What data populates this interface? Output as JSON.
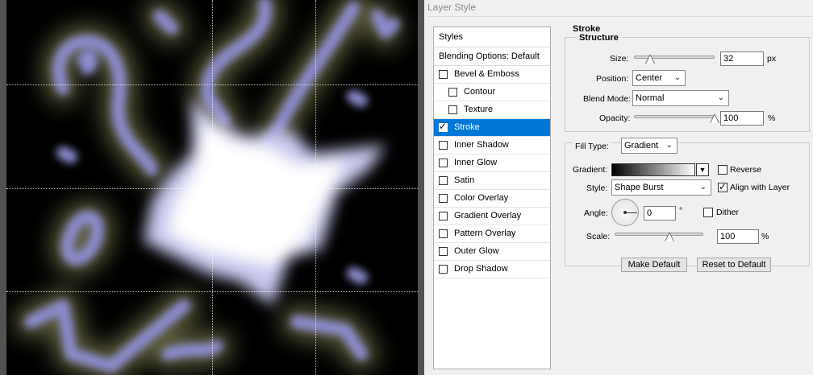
{
  "dialog": {
    "title": "Layer Style"
  },
  "styles_list": {
    "header": "Styles",
    "blending_options": "Blending Options: Default",
    "items": [
      {
        "label": "Bevel & Emboss",
        "checked": false,
        "sub": false
      },
      {
        "label": "Contour",
        "checked": false,
        "sub": true
      },
      {
        "label": "Texture",
        "checked": false,
        "sub": true
      },
      {
        "label": "Stroke",
        "checked": true,
        "sub": false,
        "selected": true
      },
      {
        "label": "Inner Shadow",
        "checked": false,
        "sub": false
      },
      {
        "label": "Inner Glow",
        "checked": false,
        "sub": false
      },
      {
        "label": "Satin",
        "checked": false,
        "sub": false
      },
      {
        "label": "Color Overlay",
        "checked": false,
        "sub": false
      },
      {
        "label": "Gradient Overlay",
        "checked": false,
        "sub": false
      },
      {
        "label": "Pattern Overlay",
        "checked": false,
        "sub": false
      },
      {
        "label": "Outer Glow",
        "checked": false,
        "sub": false
      },
      {
        "label": "Drop Shadow",
        "checked": false,
        "sub": false
      }
    ]
  },
  "stroke": {
    "title": "Stroke",
    "structure": {
      "title": "Structure",
      "size_label": "Size:",
      "size_value": "32",
      "size_unit": "px",
      "position_label": "Position:",
      "position_value": "Center",
      "blend_mode_label": "Blend Mode:",
      "blend_mode_value": "Normal",
      "opacity_label": "Opacity:",
      "opacity_value": "100",
      "opacity_unit": "%",
      "size_slider_fraction": 0.2,
      "opacity_slider_fraction": 1.0
    },
    "fill": {
      "fill_type_label": "Fill Type:",
      "fill_type_value": "Gradient",
      "gradient_label": "Gradient:",
      "reverse_label": "Reverse",
      "reverse_checked": false,
      "style_label": "Style:",
      "style_value": "Shape Burst",
      "align_label": "Align with Layer",
      "align_checked": true,
      "angle_label": "Angle:",
      "angle_value": "0",
      "angle_unit": "°",
      "dither_label": "Dither",
      "dither_checked": false,
      "scale_label": "Scale:",
      "scale_value": "100",
      "scale_unit": "%",
      "scale_slider_fraction": 0.62
    },
    "make_default_label": "Make Default",
    "reset_default_label": "Reset to Default"
  },
  "colors": {
    "stroke_glow": "#8c8ccf",
    "outer_glow": "#a8a870",
    "selection_blue": "#0078d7"
  },
  "icons": {
    "dropdown": "chevron-down-icon",
    "check": "checkmark-icon"
  }
}
